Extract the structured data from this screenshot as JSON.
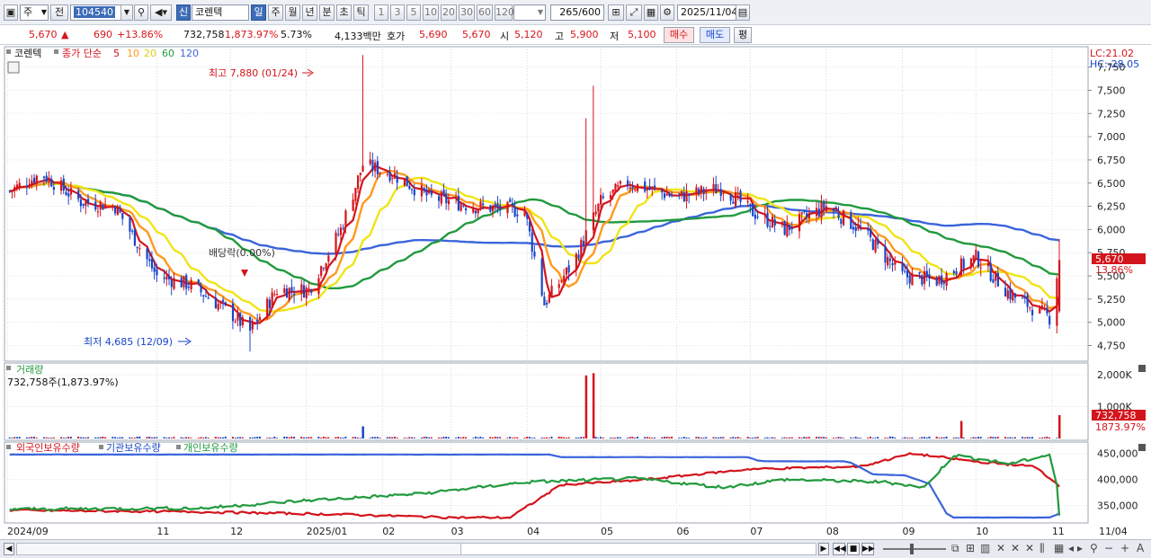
{
  "toolbar": {
    "period_select": "주",
    "prev_label": "전",
    "code": "104540",
    "badge": "신",
    "name": "코렌텍",
    "tabs": [
      "일",
      "주",
      "월",
      "년",
      "분",
      "초",
      "틱"
    ],
    "active_tab": "일",
    "intervals": [
      "1",
      "3",
      "5",
      "10",
      "20",
      "30",
      "60",
      "120"
    ],
    "count": "265",
    "count_total": "/600",
    "date": "2025/11/04"
  },
  "quote": {
    "price": "5,670",
    "arrow": "▲",
    "change": "690",
    "change_pct": "+13.86%",
    "volume": "732,758",
    "volume_pct": "1,873.97%",
    "turnover": "5.73%",
    "amount": "4,133백만",
    "bid_label": "호가",
    "bid1": "5,690",
    "bid2": "5,670",
    "open_label": "시",
    "open": "5,120",
    "high_label": "고",
    "high": "5,900",
    "low_label": "저",
    "low": "5,100",
    "buy_btn": "매수",
    "sell_btn": "매도",
    "eval_btn": "평"
  },
  "chart_data": {
    "type": "candlestick",
    "title": "코렌텍",
    "legend": {
      "label": "종가 단순",
      "periods": [
        "5",
        "10",
        "20",
        "60",
        "120"
      ],
      "colors": [
        "#d4141c",
        "#ff9a1e",
        "#f0e416",
        "#219a3e",
        "#3a64dc"
      ]
    },
    "scale_labels": {
      "lc": "LC:21.02",
      "hc": "HC:-28.05"
    },
    "price_axis": [
      "7,750",
      "7,500",
      "7,250",
      "7,000",
      "6,750",
      "6,500",
      "6,250",
      "6,000",
      "5,750",
      "5,500",
      "5,250",
      "5,000",
      "4,750"
    ],
    "price_ticks": [
      7750,
      7500,
      7250,
      7000,
      6750,
      6500,
      6250,
      6000,
      5750,
      5500,
      5250,
      5000,
      4750
    ],
    "ylim": [
      4600,
      7950
    ],
    "last_price_label": "5,670",
    "last_change_label": "13.86%",
    "annotations": {
      "high": "최고 7,880 (01/24)",
      "low": "최저 4,685 (12/09)",
      "dividend": "배당락(0.00%)"
    },
    "x_labels": [
      "2024/09",
      "11",
      "12",
      "2025/01",
      "02",
      "03",
      "04",
      "05",
      "06",
      "07",
      "08",
      "09",
      "10",
      "11",
      "11/04"
    ],
    "price_trend": [
      {
        "date": "2024-09-01",
        "close": 6400
      },
      {
        "date": "2024-09-15",
        "close": 6600
      },
      {
        "date": "2024-10-01",
        "close": 6300
      },
      {
        "date": "2024-10-15",
        "close": 6250
      },
      {
        "date": "2024-11-01",
        "close": 5500
      },
      {
        "date": "2024-11-15",
        "close": 5400
      },
      {
        "date": "2024-12-01",
        "close": 5100
      },
      {
        "date": "2024-12-09",
        "close": 4900
      },
      {
        "date": "2024-12-20",
        "close": 5350
      },
      {
        "date": "2025-01-02",
        "close": 5350
      },
      {
        "date": "2025-01-15",
        "close": 6000
      },
      {
        "date": "2025-01-24",
        "close": 6700
      },
      {
        "date": "2025-02-05",
        "close": 6600
      },
      {
        "date": "2025-02-20",
        "close": 6350
      },
      {
        "date": "2025-03-10",
        "close": 6250
      },
      {
        "date": "2025-03-31",
        "close": 6200
      },
      {
        "date": "2025-04-08",
        "close": 5200
      },
      {
        "date": "2025-04-20",
        "close": 5650
      },
      {
        "date": "2025-05-01",
        "close": 6300
      },
      {
        "date": "2025-05-12",
        "close": 6500
      },
      {
        "date": "2025-06-01",
        "close": 6350
      },
      {
        "date": "2025-06-20",
        "close": 6450
      },
      {
        "date": "2025-07-01",
        "close": 6200
      },
      {
        "date": "2025-07-15",
        "close": 6000
      },
      {
        "date": "2025-08-01",
        "close": 6250
      },
      {
        "date": "2025-08-15",
        "close": 6000
      },
      {
        "date": "2025-09-01",
        "close": 5500
      },
      {
        "date": "2025-09-15",
        "close": 5450
      },
      {
        "date": "2025-10-01",
        "close": 5700
      },
      {
        "date": "2025-10-15",
        "close": 5300
      },
      {
        "date": "2025-10-31",
        "close": 5050
      },
      {
        "date": "2025-11-04",
        "close": 5670
      }
    ],
    "volume_panel": {
      "title": "거래량",
      "caption": "732,758주(1,873.97%)",
      "axis": [
        "2,000K",
        "1,000K"
      ],
      "axis_values": [
        2000,
        1000
      ],
      "ylim_k": [
        0,
        2200
      ],
      "last_label": "732,758",
      "last_pct_label": "1873.97%",
      "spikes_k": [
        {
          "date": "2025-01-24",
          "value": 380
        },
        {
          "date": "2025-04-25",
          "value": 1980
        },
        {
          "date": "2025-04-28",
          "value": 2050
        },
        {
          "date": "2025-09-25",
          "value": 550
        },
        {
          "date": "2025-11-04",
          "value": 733
        }
      ]
    },
    "holdings_panel": {
      "series_names": [
        "외국인보유수량",
        "기관보유수량",
        "개인보유수량"
      ],
      "axis": [
        "450,000",
        "400,000",
        "350,000"
      ],
      "axis_values": [
        450000,
        400000,
        350000
      ],
      "ylim": [
        320000,
        465000
      ]
    }
  }
}
